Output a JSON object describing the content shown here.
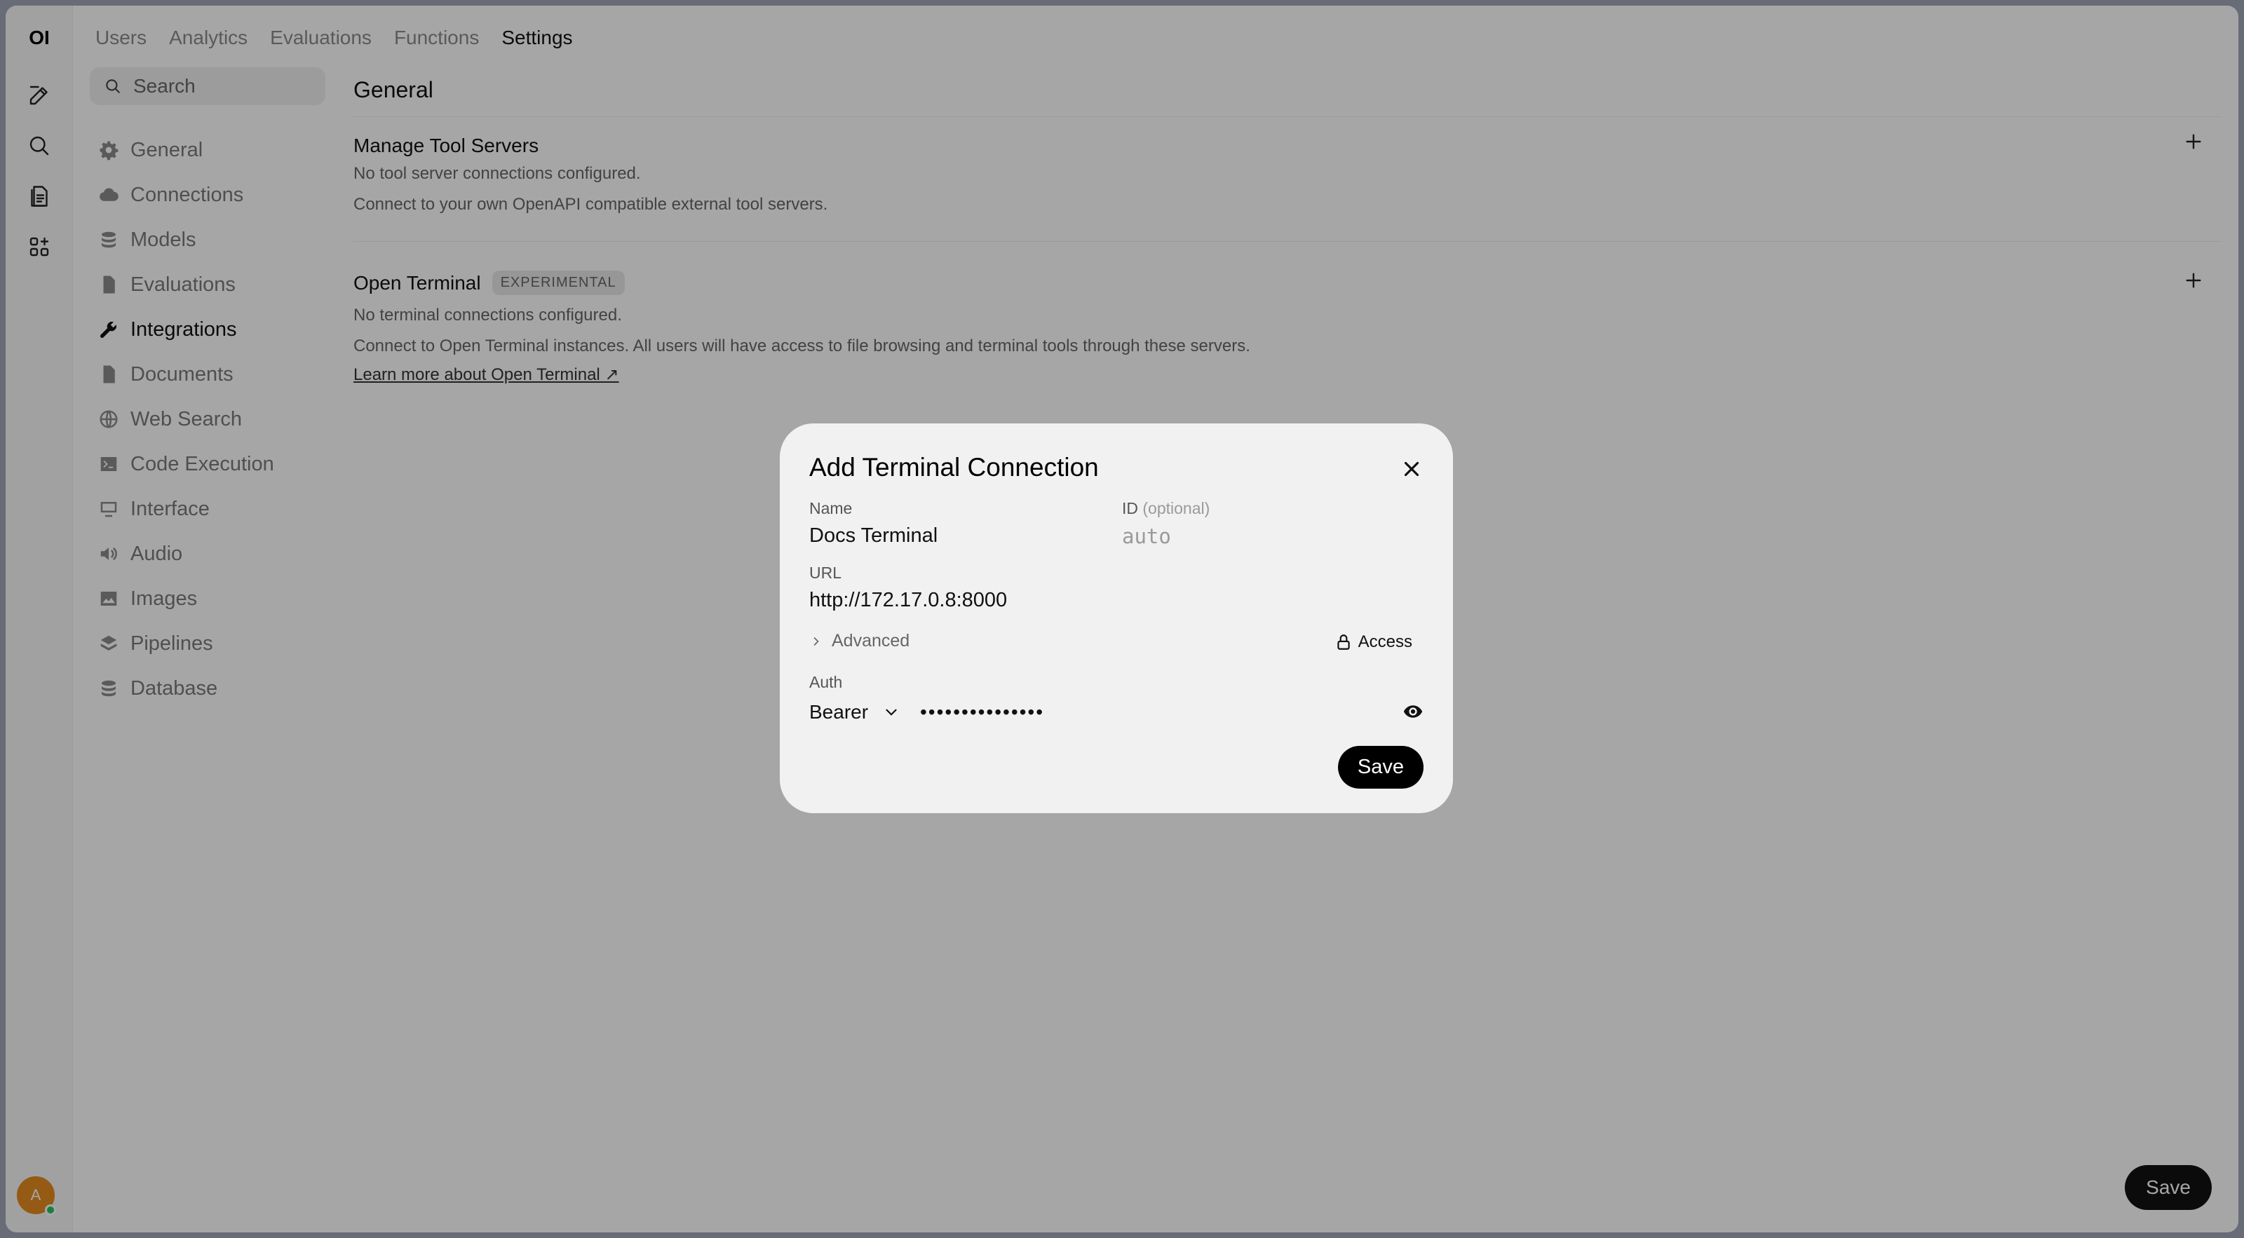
{
  "app": {
    "logo": "OI",
    "avatar_initial": "A"
  },
  "rail_icons": [
    "new-chat-icon",
    "search-icon",
    "notes-icon",
    "workspace-icon"
  ],
  "topnav": {
    "tabs": [
      {
        "label": "Users",
        "active": false
      },
      {
        "label": "Analytics",
        "active": false
      },
      {
        "label": "Evaluations",
        "active": false
      },
      {
        "label": "Functions",
        "active": false
      },
      {
        "label": "Settings",
        "active": true
      }
    ]
  },
  "search": {
    "placeholder": "Search"
  },
  "sidebar": {
    "items": [
      {
        "label": "General",
        "icon": "gear-icon"
      },
      {
        "label": "Connections",
        "icon": "cloud-icon"
      },
      {
        "label": "Models",
        "icon": "stack-icon"
      },
      {
        "label": "Evaluations",
        "icon": "document-icon"
      },
      {
        "label": "Integrations",
        "icon": "wrench-icon",
        "active": true
      },
      {
        "label": "Documents",
        "icon": "document-icon"
      },
      {
        "label": "Web Search",
        "icon": "globe-icon"
      },
      {
        "label": "Code Execution",
        "icon": "terminal-icon"
      },
      {
        "label": "Interface",
        "icon": "monitor-icon"
      },
      {
        "label": "Audio",
        "icon": "speaker-icon"
      },
      {
        "label": "Images",
        "icon": "image-icon"
      },
      {
        "label": "Pipelines",
        "icon": "layers-icon"
      },
      {
        "label": "Database",
        "icon": "database-icon"
      }
    ]
  },
  "main": {
    "title": "General",
    "tool_servers": {
      "heading": "Manage Tool Servers",
      "status": "No tool server connections configured.",
      "description": "Connect to your own OpenAPI compatible external tool servers."
    },
    "open_terminal": {
      "heading": "Open Terminal",
      "badge": "EXPERIMENTAL",
      "status": "No terminal connections configured.",
      "description": "Connect to Open Terminal instances. All users will have access to file browsing and terminal tools through these servers.",
      "link": "Learn more about Open Terminal ↗"
    },
    "save_label": "Save"
  },
  "modal": {
    "title": "Add Terminal Connection",
    "name_label": "Name",
    "name_value": "Docs Terminal",
    "id_label": "ID",
    "id_optional": "(optional)",
    "id_placeholder": "auto",
    "url_label": "URL",
    "url_value": "http://172.17.0.8:8000",
    "advanced_label": "Advanced",
    "access_label": "Access",
    "auth_label": "Auth",
    "auth_type": "Bearer",
    "auth_token_masked": "•••••••••••••••",
    "save_label": "Save"
  }
}
